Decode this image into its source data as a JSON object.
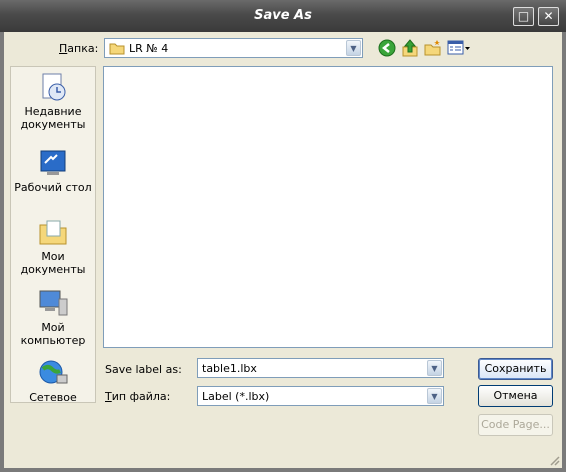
{
  "window": {
    "title": "Save As",
    "maximize_glyph": "□",
    "close_glyph": "✕"
  },
  "lookin": {
    "label": "Папка:",
    "value": "LR № 4"
  },
  "toolbar": {
    "icons": [
      "back-icon",
      "up-folder-icon",
      "new-folder-icon",
      "view-menu-icon"
    ]
  },
  "places": [
    {
      "name": "recent",
      "label": "Недавние документы"
    },
    {
      "name": "desktop",
      "label": "Рабочий стол"
    },
    {
      "name": "mydocs",
      "label": "Мои документы"
    },
    {
      "name": "mycomputer",
      "label": "Мой компьютер"
    },
    {
      "name": "network",
      "label": "Сетевое"
    }
  ],
  "filename": {
    "label": "Save label as:",
    "value": "table1.lbx"
  },
  "filetype": {
    "label": "Тип файла:",
    "value": "Label (*.lbx)"
  },
  "buttons": {
    "save": "Сохранить",
    "cancel": "Отмена",
    "codepage": "Code Page..."
  }
}
